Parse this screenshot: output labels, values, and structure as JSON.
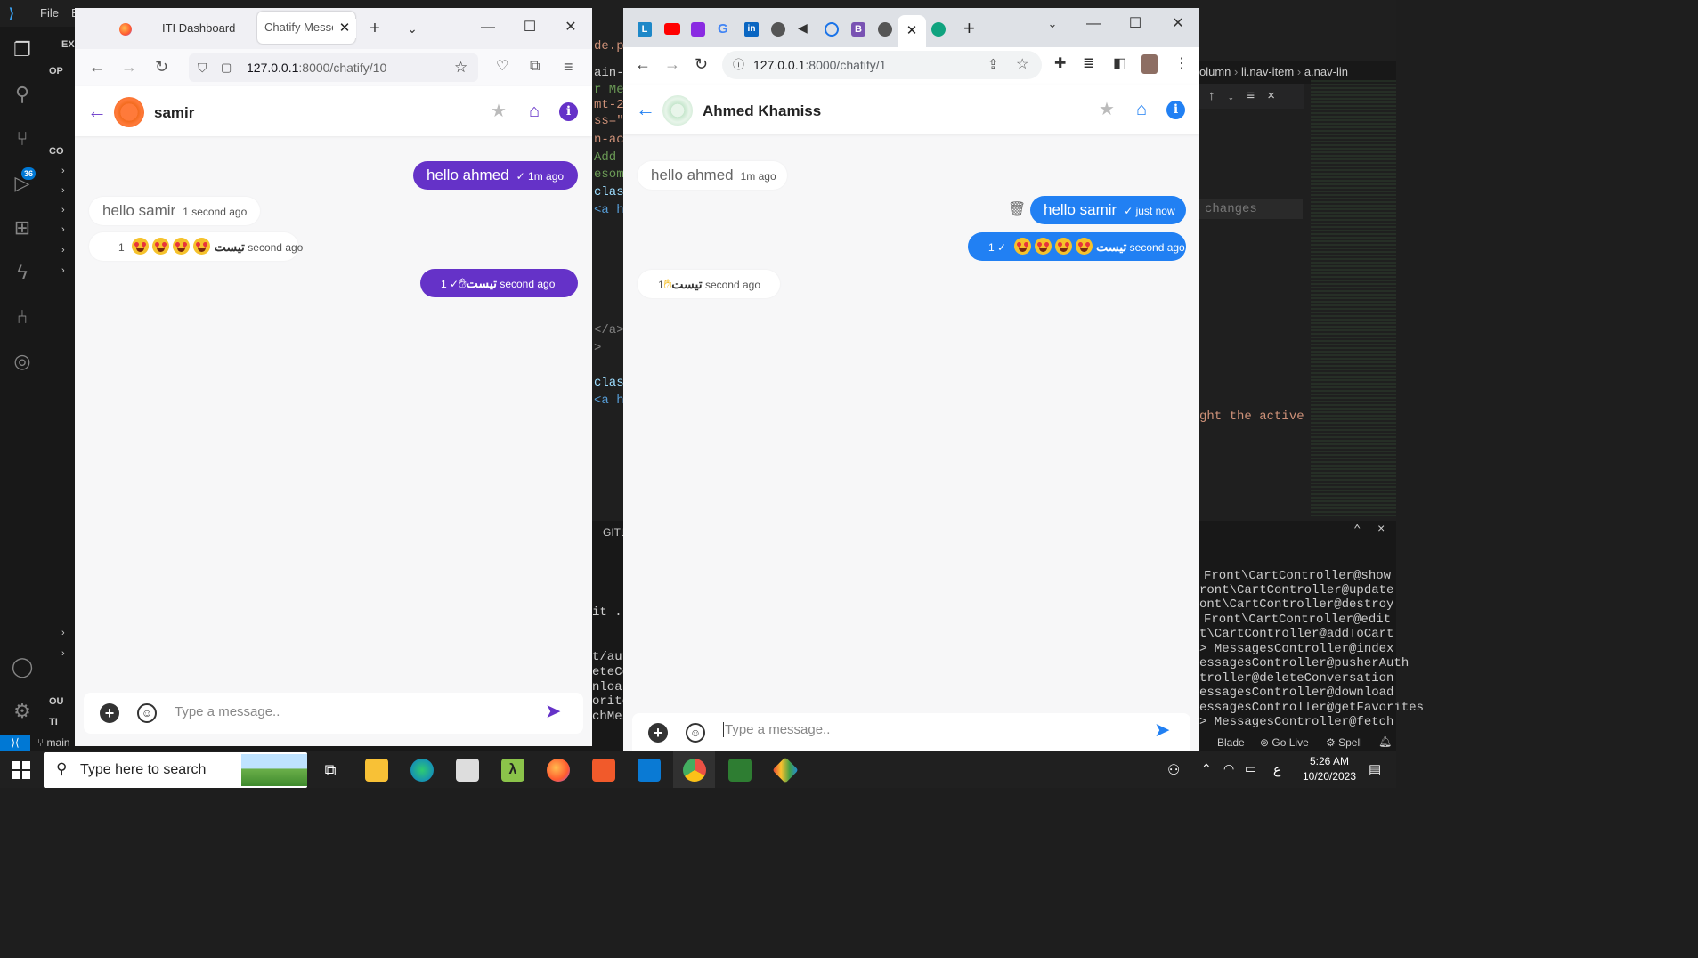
{
  "vscode": {
    "menu_file": "File",
    "menu_e": "E",
    "explorer_labels": [
      "EX",
      "OP",
      "CO",
      "OU",
      "TI"
    ],
    "code_lines": [
      "de.php",
      "ain-sid",
      "r Men",
      "mt-2",
      "ss=\"n",
      "n-acc",
      " Add",
      "esome",
      "clas",
      "<a h",
      "</a>",
      ">",
      "clas",
      "<a h"
    ],
    "panel_tab": "GITL",
    "terminal_left": [
      "t/aut",
      "eteCo",
      "nloa",
      "orite",
      "chMes",
      "it .."
    ],
    "terminal_right": [
      "Front\\CartController@show",
      "ront\\CartController@update",
      "ont\\CartController@destroy",
      "Front\\CartController@edit",
      "t\\CartController@addToCart",
      "> MessagesController@index",
      "essagesController@pusherAuth",
      "troller@deleteConversation",
      "essagesController@download",
      "essagesController@getFavorites",
      "> MessagesController@fetch"
    ],
    "breadcrumb": [
      "olumn",
      "li.nav-item",
      "a.nav-lin"
    ],
    "find_placeholder": "changes",
    "code_comment": "ght the active",
    "badge_count": "36",
    "status_branch": "main",
    "status_items": [
      "Blade",
      "Go Live",
      "Spell"
    ]
  },
  "firefox": {
    "tabs": [
      {
        "label": ""
      },
      {
        "label": "ITI Dashboard"
      },
      {
        "label": "Chatify Messen"
      }
    ],
    "url": "127.0.0.1:8000/chatify/10",
    "url_host": "127.0.0.1",
    "url_rest": ":8000/chatify/10",
    "contact_name": "samir",
    "messages": [
      {
        "dir": "out",
        "text": "hello ahmed",
        "time": "1m ago"
      },
      {
        "dir": "in",
        "text": "hello samir",
        "time": "1 second ago"
      },
      {
        "dir": "in",
        "text": "تيست",
        "emojis": 4,
        "time": "1 second ago"
      },
      {
        "dir": "out",
        "text": "تيست",
        "wave": true,
        "time": "1 second ago"
      }
    ],
    "composer_placeholder": "Type a message..",
    "accent": "#6532c8"
  },
  "chrome": {
    "tabs": [
      "L",
      "",
      "",
      "",
      "",
      "",
      "",
      "",
      "B",
      "",
      "",
      ""
    ],
    "url": "127.0.0.1:8000/chatify/1",
    "url_host": "127.0.0.1",
    "url_rest": ":8000/chatify/1",
    "contact_name": "Ahmed Khamiss",
    "messages": [
      {
        "dir": "in",
        "text": "hello ahmed",
        "time": "1m ago"
      },
      {
        "dir": "out",
        "text": "hello samir",
        "time": "just now"
      },
      {
        "dir": "out",
        "text": "تيست",
        "emojis": 4,
        "time": "1 second ago"
      },
      {
        "dir": "in",
        "text": "تيست",
        "wave": true,
        "time": "1 second ago"
      }
    ],
    "composer_placeholder": "Type a message..",
    "accent": "#2180f3"
  },
  "taskbar": {
    "search_placeholder": "Type here to search",
    "time": "5:26 AM",
    "date": "10/20/2023",
    "lang": "ع"
  }
}
